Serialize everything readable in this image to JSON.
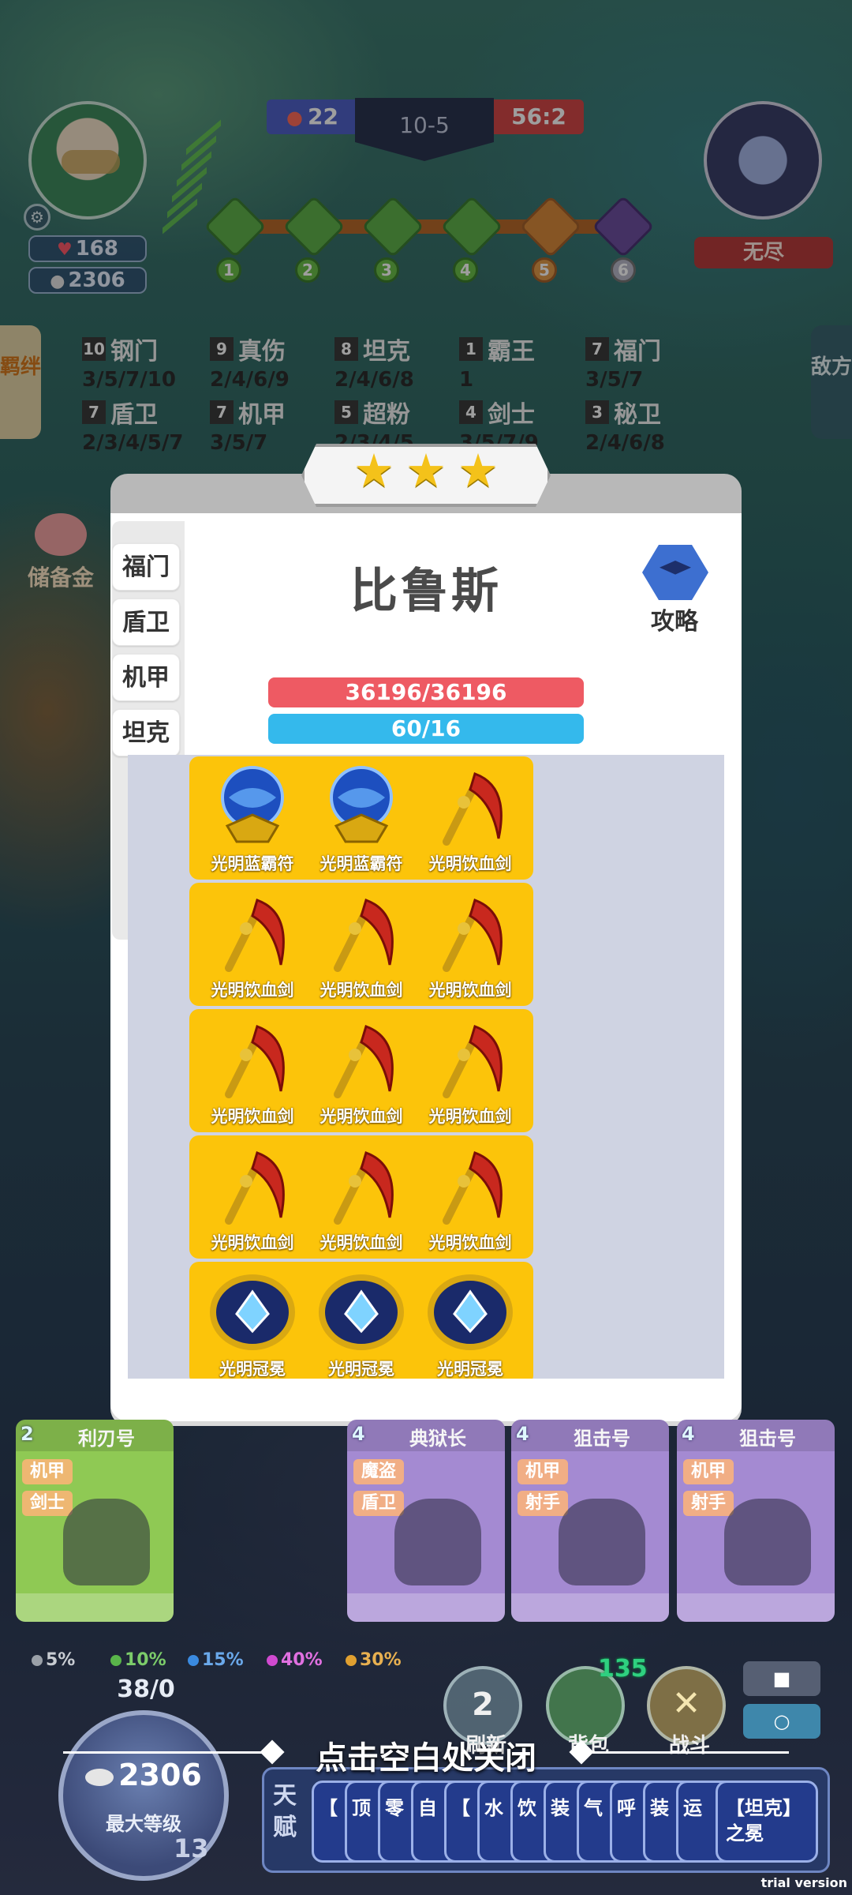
{
  "hud": {
    "hp": "168",
    "gold": "2306",
    "blue_score": "22",
    "round": "10-5",
    "red_score": "56:2",
    "mode": "无尽",
    "stages": [
      "1",
      "2",
      "3",
      "4",
      "5",
      "6"
    ]
  },
  "side_tabs": {
    "left": "羁绊",
    "right": "敌方"
  },
  "bonds": [
    {
      "count": "10",
      "name": "钢门",
      "levels": "3/5/7/10"
    },
    {
      "count": "9",
      "name": "真伤",
      "levels": "2/4/6/9"
    },
    {
      "count": "8",
      "name": "坦克",
      "levels": "2/4/6/8"
    },
    {
      "count": "1",
      "name": "霸王",
      "levels": "1"
    },
    {
      "count": "7",
      "name": "福门",
      "levels": "3/5/7"
    },
    {
      "count": "7",
      "name": "盾卫",
      "levels": "2/3/4/5/7"
    },
    {
      "count": "7",
      "name": "机甲",
      "levels": "3/5/7"
    },
    {
      "count": "5",
      "name": "超粉",
      "levels": "2/3/4/5"
    },
    {
      "count": "4",
      "name": "剑士",
      "levels": "3/5/7/9"
    },
    {
      "count": "3",
      "name": "秘卫",
      "levels": "2/4/6/8"
    }
  ],
  "piggy_label": "储备金",
  "dialog": {
    "stars": 3,
    "hero_name": "比鲁斯",
    "guide_label": "攻略",
    "hp_text": "36196/36196",
    "mp_text": "60/16",
    "traits": [
      "福门",
      "盾卫",
      "机甲",
      "坦克"
    ],
    "equipment": [
      {
        "name": "光明蓝霸符",
        "icon": "orb-icon"
      },
      {
        "name": "光明蓝霸符",
        "icon": "orb-icon"
      },
      {
        "name": "光明饮血剑",
        "icon": "scythe-icon"
      },
      {
        "name": "光明饮血剑",
        "icon": "scythe-icon"
      },
      {
        "name": "光明饮血剑",
        "icon": "scythe-icon"
      },
      {
        "name": "光明饮血剑",
        "icon": "scythe-icon"
      },
      {
        "name": "光明饮血剑",
        "icon": "scythe-icon"
      },
      {
        "name": "光明饮血剑",
        "icon": "scythe-icon"
      },
      {
        "name": "光明饮血剑",
        "icon": "scythe-icon"
      },
      {
        "name": "光明饮血剑",
        "icon": "scythe-icon"
      },
      {
        "name": "光明饮血剑",
        "icon": "scythe-icon"
      },
      {
        "name": "光明饮血剑",
        "icon": "scythe-icon"
      },
      {
        "name": "光明冠冕",
        "icon": "crown-icon"
      },
      {
        "name": "光明冠冕",
        "icon": "crown-icon"
      },
      {
        "name": "光明冠冕",
        "icon": "crown-icon"
      }
    ]
  },
  "shop": {
    "cards": [
      {
        "cost": "2",
        "name": "利刃号",
        "tags": [
          "机甲",
          "剑士"
        ],
        "color": "green"
      },
      {
        "cost": "4",
        "name": "典狱长",
        "tags": [
          "魔盗",
          "盾卫"
        ],
        "color": "purple"
      },
      {
        "cost": "4",
        "name": "狙击号",
        "tags": [
          "机甲",
          "射手"
        ],
        "color": "purple"
      },
      {
        "cost": "4",
        "name": "狙击号",
        "tags": [
          "机甲",
          "射手"
        ],
        "color": "purple"
      }
    ],
    "odds": [
      {
        "value": "5%",
        "color": "#9aa0a8"
      },
      {
        "value": "10%",
        "color": "#59b54a"
      },
      {
        "value": "15%",
        "color": "#3a8ae0"
      },
      {
        "value": "40%",
        "color": "#d04ad0"
      },
      {
        "value": "30%",
        "color": "#e0a030"
      }
    ],
    "xp": "38/0",
    "gold": "2306",
    "max_level": "最大等级",
    "level": "13",
    "refresh_label": "刷新",
    "refresh_cost": "2",
    "bag_label": "背包",
    "bag_count": "135",
    "fight_label": "战斗",
    "talent_title": "天赋",
    "talent_cards": [
      "【",
      "顶",
      "零",
      "自",
      "【",
      "水",
      "饮",
      "装",
      "气",
      "呼",
      "装",
      "运",
      "【坦克】之冕"
    ]
  },
  "close_hint": "点击空白处关闭",
  "watermark": "trial version"
}
